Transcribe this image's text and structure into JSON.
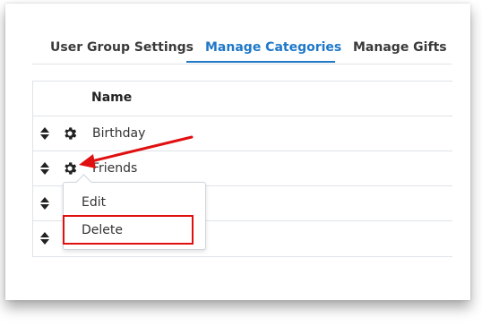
{
  "tabs": [
    {
      "label": "User Group Settings"
    },
    {
      "label": "Manage Categories",
      "active": true
    },
    {
      "label": "Manage Gifts"
    }
  ],
  "table": {
    "header_name": "Name",
    "rows": [
      {
        "label": "Birthday"
      },
      {
        "label": "Friends"
      },
      {
        "label": ""
      },
      {
        "label": ""
      }
    ]
  },
  "context_menu": {
    "items": [
      {
        "label": "Edit"
      },
      {
        "label": "Delete",
        "highlighted": true
      }
    ]
  },
  "colors": {
    "accent": "#1f78c8",
    "annotation": "#e01010",
    "border": "#dfe3e8",
    "icon": "#222222"
  },
  "icons": [
    "sort-handle-icon",
    "gear-icon",
    "annotation-arrow"
  ]
}
